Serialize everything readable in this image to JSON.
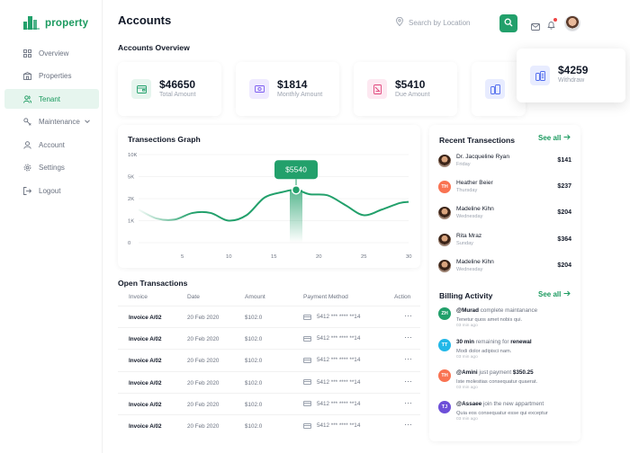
{
  "brand": {
    "name": "property",
    "color": "#22a06b"
  },
  "sidebar": {
    "items": [
      {
        "label": "Overview",
        "icon": "grid-icon"
      },
      {
        "label": "Properties",
        "icon": "building-icon"
      },
      {
        "label": "Tenant",
        "icon": "users-icon",
        "active": true
      },
      {
        "label": "Maintenance",
        "icon": "wrench-icon"
      },
      {
        "label": "Account",
        "icon": "user-icon"
      },
      {
        "label": "Settings",
        "icon": "gear-icon"
      },
      {
        "label": "Logout",
        "icon": "logout-icon"
      }
    ]
  },
  "header": {
    "title": "Accounts",
    "search_placeholder": "Search by Location"
  },
  "overview": {
    "title": "Accounts Overview",
    "cards": [
      {
        "amount": "$46650",
        "label": "Total Amount",
        "icon": "wallet-icon",
        "color": "#e6f5ee"
      },
      {
        "amount": "$1814",
        "label": "Monthly Amount",
        "icon": "cash-icon",
        "color": "#efeaff"
      },
      {
        "amount": "$5410",
        "label": "Due Amount",
        "icon": "receipt-icon",
        "color": "#fde8f1"
      },
      {
        "amount": "$4259",
        "label": "Withdraw",
        "icon": "coins-icon",
        "color": "#e8ecff"
      }
    ]
  },
  "graph": {
    "title": "Transections Graph",
    "tooltip": "$5540"
  },
  "chart_data": {
    "type": "line",
    "title": "Transections Graph",
    "xlabel": "",
    "ylabel": "",
    "x_ticks": [
      5,
      10,
      15,
      20,
      25,
      30
    ],
    "y_ticks": [
      "0",
      "1K",
      "2K",
      "5K",
      "10K"
    ],
    "y_tick_values": [
      0,
      1,
      2,
      3,
      4
    ],
    "xlim": [
      0,
      30
    ],
    "ylim": [
      0,
      4
    ],
    "series": [
      {
        "x": [
          0,
          2,
          4,
          6,
          8,
          10,
          12,
          14,
          16,
          17.5,
          19,
          21,
          23,
          25,
          27,
          29,
          30
        ],
        "values": [
          1.5,
          1.1,
          1.05,
          1.35,
          1.35,
          1.0,
          1.25,
          2.05,
          2.3,
          2.4,
          2.2,
          2.15,
          1.7,
          1.25,
          1.5,
          1.8,
          1.85
        ]
      }
    ],
    "highlight": {
      "x": 17.5,
      "label": "$5540"
    },
    "grid": true,
    "color": "#22a06b"
  },
  "open_transactions": {
    "title": "Open Transactions",
    "columns": [
      "Invoice",
      "Date",
      "Amount",
      "Payment Method",
      "Action"
    ],
    "rows": [
      {
        "invoice": "Invoice A/02",
        "date": "20 Feb 2020",
        "amount": "$102.0",
        "method": "5412 *** **** **14"
      },
      {
        "invoice": "Invoice A/02",
        "date": "20 Feb 2020",
        "amount": "$102.0",
        "method": "5412 *** **** **14"
      },
      {
        "invoice": "Invoice A/02",
        "date": "20 Feb 2020",
        "amount": "$102.0",
        "method": "5412 *** **** **14"
      },
      {
        "invoice": "Invoice A/02",
        "date": "20 Feb 2020",
        "amount": "$102.0",
        "method": "5412 *** **** **14"
      },
      {
        "invoice": "Invoice A/02",
        "date": "20 Feb 2020",
        "amount": "$102.0",
        "method": "5412 *** **** **14"
      },
      {
        "invoice": "Invoice A/02",
        "date": "20 Feb 2020",
        "amount": "$102.0",
        "method": "5412 *** **** **14"
      }
    ]
  },
  "recent": {
    "title": "Recent Transections",
    "see_all": "See all",
    "items": [
      {
        "name": "Dr. Jacqueline Ryan",
        "day": "Friday",
        "amount": "$141",
        "avatar": "photo"
      },
      {
        "name": "Heather Beier",
        "day": "Thursday",
        "amount": "$237",
        "avatar": "TH",
        "color": "#f97352"
      },
      {
        "name": "Madeline Kihn",
        "day": "Wednesday",
        "amount": "$204",
        "avatar": "photo"
      },
      {
        "name": "Rita Mraz",
        "day": "Sunday",
        "amount": "$364",
        "avatar": "photo"
      },
      {
        "name": "Madeline Kihn",
        "day": "Wednesday",
        "amount": "$204",
        "avatar": "photo"
      }
    ]
  },
  "billing": {
    "title": "Billing Activity",
    "see_all": "See all",
    "items": [
      {
        "initials": "ZH",
        "color": "#22a06b",
        "bold": "@Murad",
        "text": " complete maintanance",
        "sub": "Tenetur quos amet nobis qui.",
        "time": "03 min ago"
      },
      {
        "initials": "TT",
        "color": "#22b8e8",
        "bold": "30 min",
        "text": " remaining  for ",
        "bold2": "renewal",
        "sub": "Modi dolor adipisci nam.",
        "time": "03 min ago"
      },
      {
        "initials": "TH",
        "color": "#f97352",
        "bold": "@Amini",
        "text": " just payment ",
        "bold2": "$350.25",
        "sub": "Iste molestias consequatur quaerat.",
        "time": "03 min ago"
      },
      {
        "initials": "TJ",
        "color": "#6d4fd8",
        "bold": "@Assaee",
        "text": " join the new appartment",
        "sub": "Quia eos consequatur esse qui exceptur",
        "time": "03 min ago"
      }
    ]
  }
}
